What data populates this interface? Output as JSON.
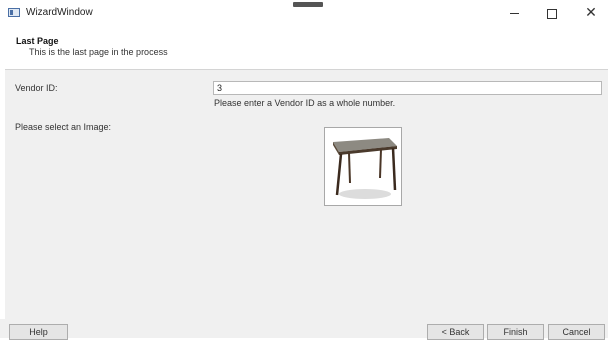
{
  "window": {
    "title": "WizardWindow",
    "icon": "app-window-icon",
    "controls": {
      "minimize_icon": "minimize-icon",
      "maximize_icon": "maximize-icon",
      "close_icon": "close-icon"
    }
  },
  "header": {
    "title": "Last Page",
    "subtitle": "This is the last page in the process"
  },
  "form": {
    "vendor_label": "Vendor ID:",
    "vendor_value": "3",
    "vendor_hint": "Please enter a Vendor ID as a whole number.",
    "image_label": "Please select an Image:",
    "image_icon": "table-image"
  },
  "footer": {
    "help": "Help",
    "back": "< Back",
    "finish": "Finish",
    "cancel": "Cancel"
  }
}
